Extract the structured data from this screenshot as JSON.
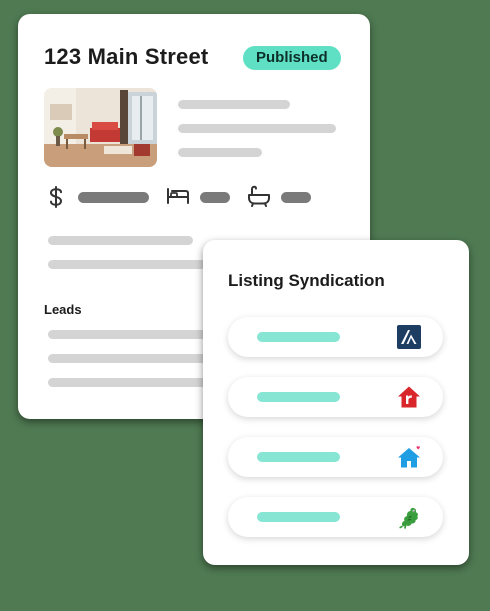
{
  "listing": {
    "title": "123 Main Street",
    "status_badge": "Published",
    "leads_heading": "Leads",
    "icons": [
      "dollar-icon",
      "bed-icon",
      "bathtub-icon"
    ]
  },
  "syndication": {
    "title": "Listing Syndication",
    "partners": [
      {
        "icon": "triangle-logo-icon",
        "color": "#1d3d63"
      },
      {
        "icon": "r-house-logo-icon",
        "color": "#d8262b"
      },
      {
        "icon": "blue-house-logo-icon",
        "color": "#1f9ee3"
      },
      {
        "icon": "green-dragon-logo-icon",
        "color": "#3a9d3e"
      }
    ]
  },
  "colors": {
    "background": "#4f7a52",
    "badge": "#5fe0c4",
    "placeholder_light": "#d4d4d4",
    "placeholder_dark": "#7a7a7a",
    "placeholder_mint": "#86e6d3"
  }
}
